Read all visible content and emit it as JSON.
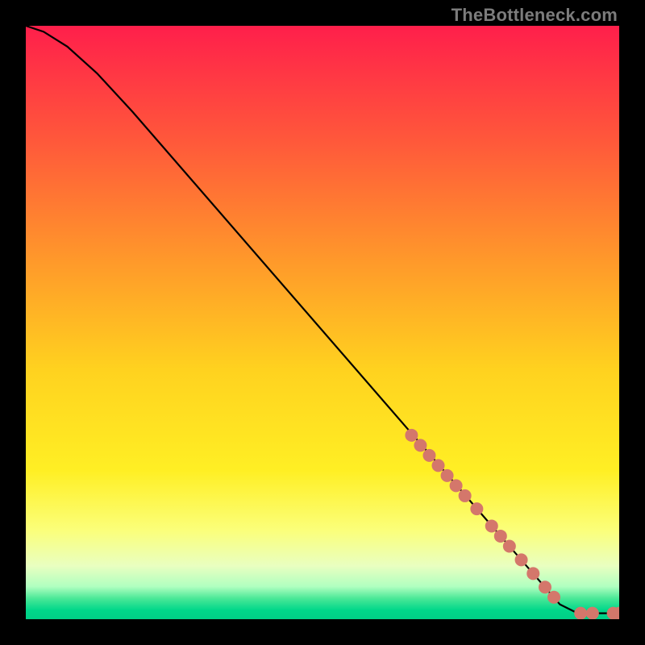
{
  "watermark": "TheBottleneck.com",
  "chart_data": {
    "type": "line",
    "title": "",
    "xlabel": "",
    "ylabel": "",
    "xlim": [
      0,
      100
    ],
    "ylim": [
      0,
      100
    ],
    "grid": false,
    "background_gradient": [
      {
        "pos": 0.0,
        "color": "#ff1f4b"
      },
      {
        "pos": 0.2,
        "color": "#ff5a3a"
      },
      {
        "pos": 0.4,
        "color": "#ff9a2a"
      },
      {
        "pos": 0.58,
        "color": "#ffd21f"
      },
      {
        "pos": 0.75,
        "color": "#ffef24"
      },
      {
        "pos": 0.85,
        "color": "#fbff7a"
      },
      {
        "pos": 0.91,
        "color": "#e9ffc0"
      },
      {
        "pos": 0.945,
        "color": "#b0ffc0"
      },
      {
        "pos": 0.965,
        "color": "#4ae897"
      },
      {
        "pos": 0.985,
        "color": "#00d78a"
      },
      {
        "pos": 1.0,
        "color": "#00cf86"
      }
    ],
    "series": [
      {
        "name": "curve",
        "stroke": "#000000",
        "points": [
          {
            "x": 0.0,
            "y": 100.0
          },
          {
            "x": 3.0,
            "y": 99.0
          },
          {
            "x": 7.0,
            "y": 96.5
          },
          {
            "x": 12.0,
            "y": 92.0
          },
          {
            "x": 18.0,
            "y": 85.5
          },
          {
            "x": 90.0,
            "y": 2.5
          },
          {
            "x": 93.0,
            "y": 1.0
          },
          {
            "x": 100.0,
            "y": 1.0
          }
        ]
      }
    ],
    "markers": {
      "color": "#d4776b",
      "radius_px": 8,
      "points": [
        {
          "x": 65.0,
          "y": 31.0
        },
        {
          "x": 66.5,
          "y": 29.3
        },
        {
          "x": 68.0,
          "y": 27.6
        },
        {
          "x": 69.5,
          "y": 25.9
        },
        {
          "x": 71.0,
          "y": 24.2
        },
        {
          "x": 72.5,
          "y": 22.5
        },
        {
          "x": 74.0,
          "y": 20.8
        },
        {
          "x": 76.0,
          "y": 18.6
        },
        {
          "x": 78.5,
          "y": 15.7
        },
        {
          "x": 80.0,
          "y": 14.0
        },
        {
          "x": 81.5,
          "y": 12.3
        },
        {
          "x": 83.5,
          "y": 10.0
        },
        {
          "x": 85.5,
          "y": 7.7
        },
        {
          "x": 87.5,
          "y": 5.4
        },
        {
          "x": 89.0,
          "y": 3.7
        },
        {
          "x": 93.5,
          "y": 1.0
        },
        {
          "x": 95.5,
          "y": 1.0
        },
        {
          "x": 99.0,
          "y": 1.0
        },
        {
          "x": 100.0,
          "y": 1.0
        }
      ]
    }
  }
}
